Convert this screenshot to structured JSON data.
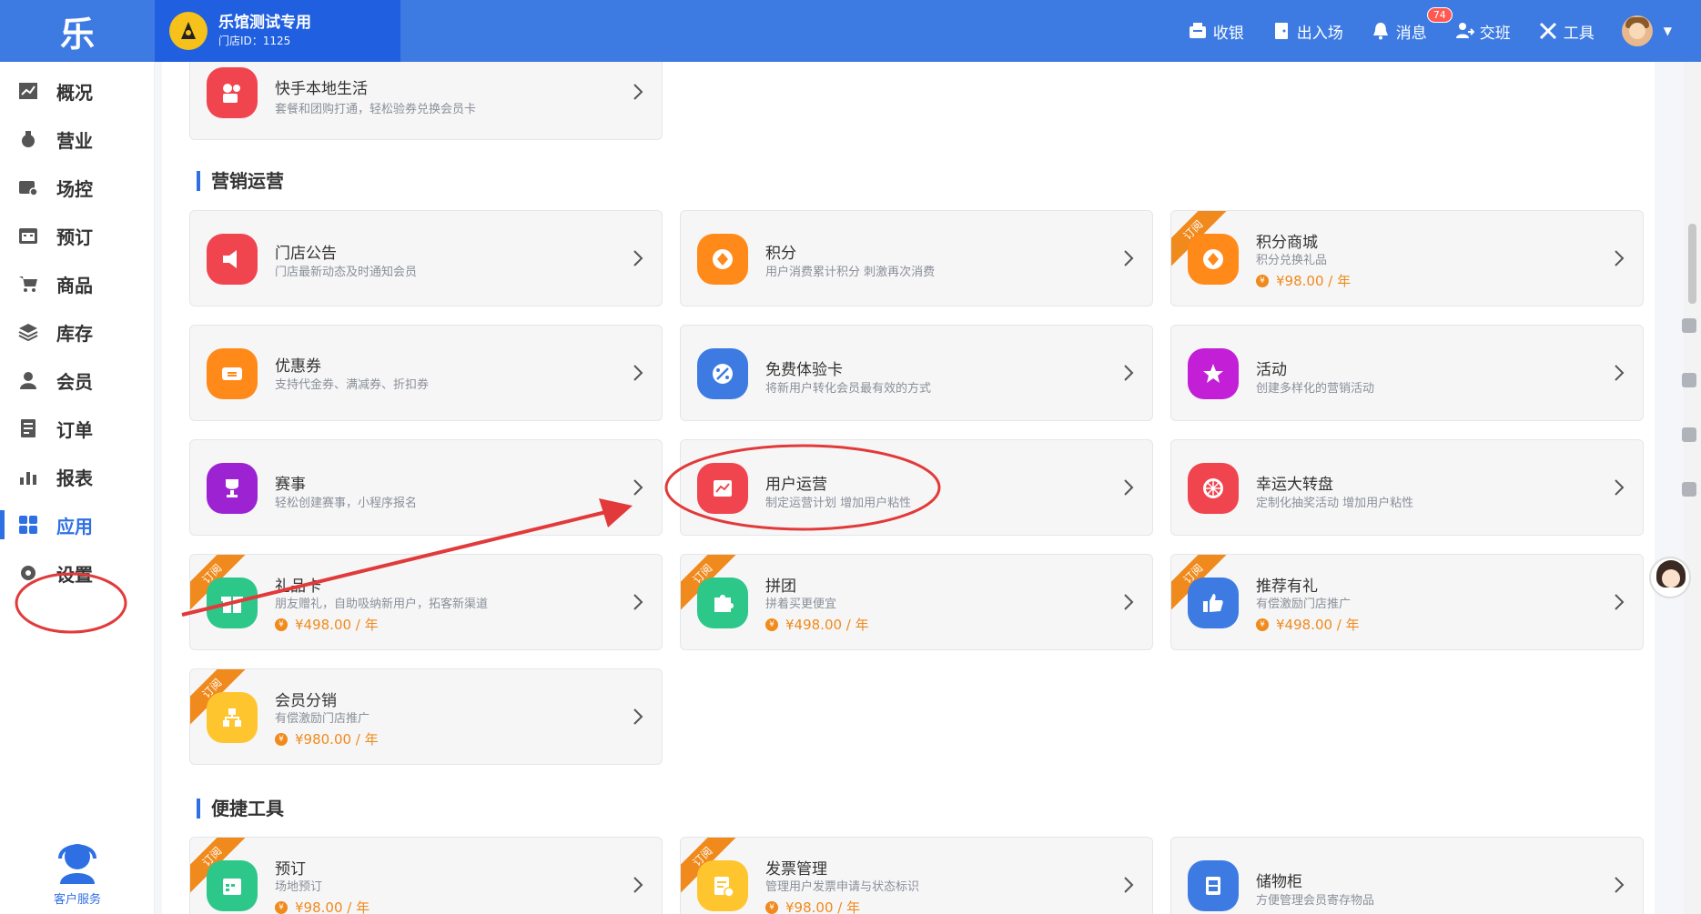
{
  "header": {
    "logo": "乐",
    "store_name": "乐馆测试专用",
    "store_id": "门店ID：1125",
    "tools": [
      {
        "label": "收银",
        "icon": "cashier-icon"
      },
      {
        "label": "出入场",
        "icon": "door-icon"
      },
      {
        "label": "消息",
        "icon": "bell-icon",
        "badge": "74"
      },
      {
        "label": "交班",
        "icon": "handover-icon"
      },
      {
        "label": "工具",
        "icon": "tools-icon"
      }
    ]
  },
  "sidebar": {
    "items": [
      {
        "label": "概况",
        "icon": "chart-icon"
      },
      {
        "label": "营业",
        "icon": "money-bag-icon"
      },
      {
        "label": "场控",
        "icon": "venue-control-icon"
      },
      {
        "label": "预订",
        "icon": "calendar-icon"
      },
      {
        "label": "商品",
        "icon": "cart-icon"
      },
      {
        "label": "库存",
        "icon": "layers-icon"
      },
      {
        "label": "会员",
        "icon": "member-icon"
      },
      {
        "label": "订单",
        "icon": "order-icon"
      },
      {
        "label": "报表",
        "icon": "report-icon"
      },
      {
        "label": "应用",
        "icon": "apps-icon",
        "active": true
      },
      {
        "label": "设置",
        "icon": "gear-icon"
      }
    ],
    "customer_service": "客户服务"
  },
  "sections": {
    "marketing_title": "营销运营",
    "tools_title": "便捷工具"
  },
  "ribbon_label": "订阅",
  "cards": {
    "kuaishou": {
      "name": "快手本地生活",
      "desc": "套餐和团购打通，轻松验券兑换会员卡",
      "color": "#f0444f"
    },
    "notice": {
      "name": "门店公告",
      "desc": "门店最新动态及时通知会员",
      "color": "#f0444f"
    },
    "points": {
      "name": "积分",
      "desc": "用户消费累计积分 刺激再次消费",
      "color": "#ff8a1a"
    },
    "points_mall": {
      "name": "积分商城",
      "desc": "积分兑换礼品",
      "price": "¥98.00 / 年",
      "color": "#ff8a1a"
    },
    "coupon": {
      "name": "优惠券",
      "desc": "支持代金券、满减券、折扣券",
      "color": "#ff8a1a"
    },
    "trial_card": {
      "name": "免费体验卡",
      "desc": "将新用户转化会员最有效的方式",
      "color": "#3d7be3"
    },
    "activity": {
      "name": "活动",
      "desc": "创建多样化的营销活动",
      "color": "#c21fd6"
    },
    "contest": {
      "name": "赛事",
      "desc": "轻松创建赛事，小程序报名",
      "color": "#9d22d2"
    },
    "user_ops": {
      "name": "用户运营",
      "desc": "制定运营计划 增加用户粘性",
      "color": "#f0444f"
    },
    "lucky_wheel": {
      "name": "幸运大转盘",
      "desc": "定制化抽奖活动 增加用户粘性",
      "color": "#f0444f"
    },
    "gift_card": {
      "name": "礼品卡",
      "desc": "朋友赠礼，自助吸纳新用户，拓客新渠道",
      "price": "¥498.00 / 年",
      "color": "#2ec78a"
    },
    "group_buy": {
      "name": "拼团",
      "desc": "拼着买更便宜",
      "price": "¥498.00 / 年",
      "color": "#2ec78a"
    },
    "referral": {
      "name": "推荐有礼",
      "desc": "有偿激励门店推广",
      "price": "¥498.00 / 年",
      "color": "#3d7be3"
    },
    "distribution": {
      "name": "会员分销",
      "desc": "有偿激励门店推广",
      "price": "¥980.00 / 年",
      "color": "#ffc52e"
    },
    "booking": {
      "name": "预订",
      "desc": "场地预订",
      "price": "¥98.00 / 年",
      "color": "#2ec78a"
    },
    "invoice": {
      "name": "发票管理",
      "desc": "管理用户发票申请与状态标识",
      "price": "¥98.00 / 年",
      "color": "#ffc52e"
    },
    "locker": {
      "name": "储物柜",
      "desc": "方便管理会员寄存物品",
      "color": "#3d7be3"
    }
  },
  "annotation_color": "#e23a3a"
}
